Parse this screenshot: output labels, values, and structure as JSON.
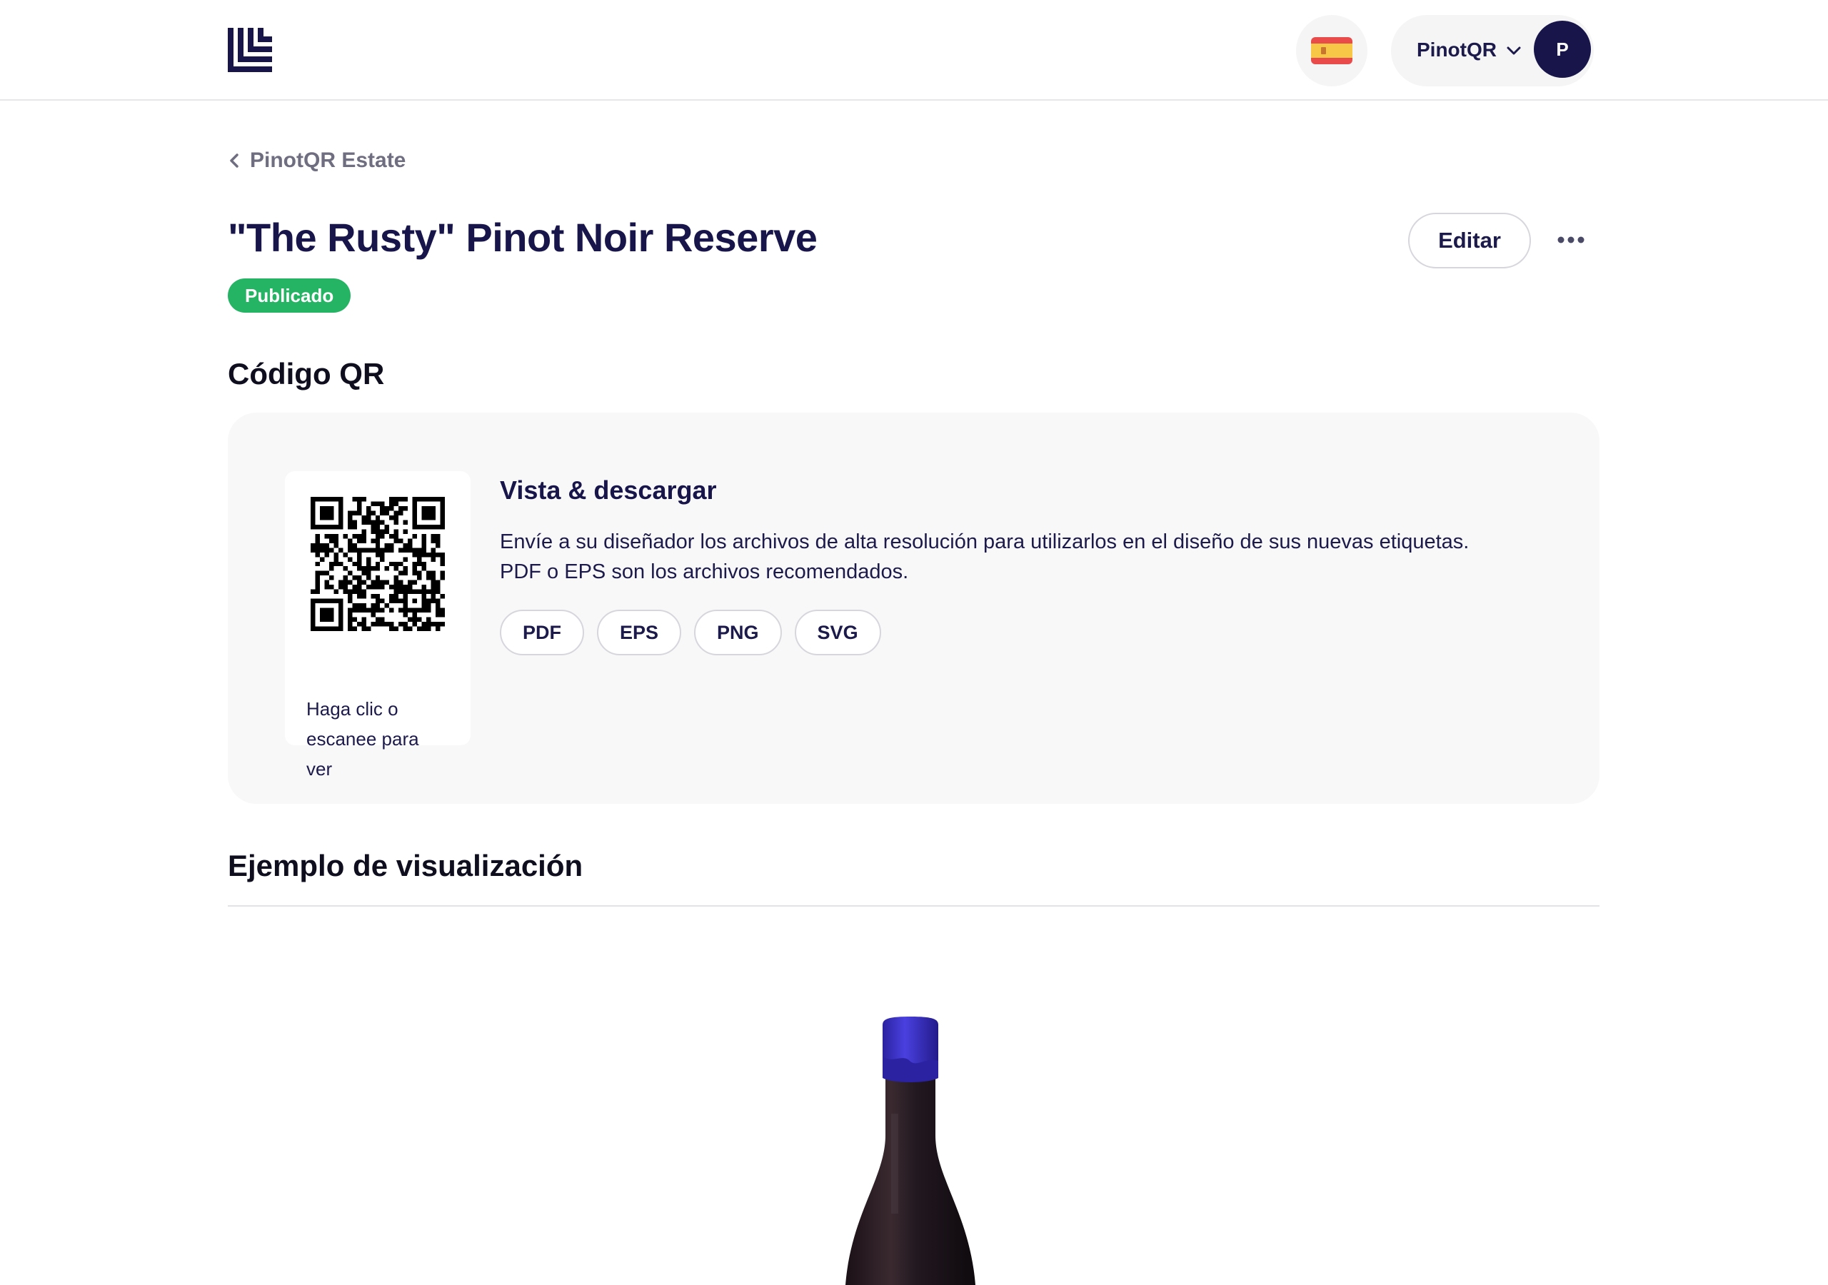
{
  "header": {
    "account_name": "PinotQR",
    "avatar_initial": "P",
    "language_flag": "spain-flag-icon",
    "colors": {
      "brand_navy": "#17154a",
      "surface": "#f5f5f6"
    }
  },
  "breadcrumb": {
    "label": "PinotQR Estate"
  },
  "product": {
    "title": "\"The Rusty\" Pinot Noir Reserve",
    "status": "Publicado",
    "status_color": "#25b364"
  },
  "actions": {
    "edit_label": "Editar",
    "more_icon": "more-horizontal-icon"
  },
  "qr_section": {
    "heading": "Código QR",
    "caption": "Haga clic o escanee para ver",
    "info_title": "Vista & descargar",
    "info_text_line1": "Envíe a su diseñador los archivos de alta resolución para utilizarlos en el diseño de sus nuevas etiquetas.",
    "info_text_line2": "PDF o EPS son los archivos recomendados.",
    "downloads": [
      "PDF",
      "EPS",
      "PNG",
      "SVG"
    ]
  },
  "preview_section": {
    "heading": "Ejemplo de visualización"
  }
}
